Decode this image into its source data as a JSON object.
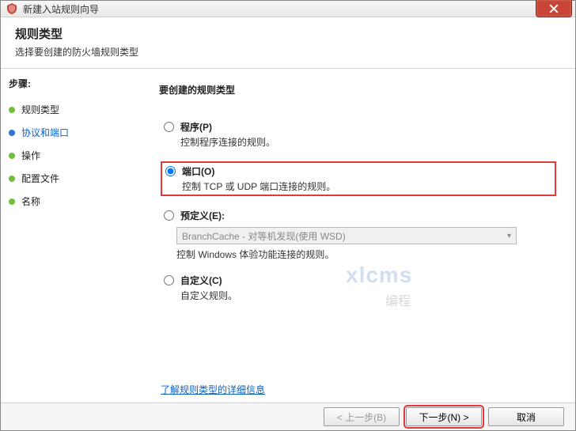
{
  "window": {
    "title": "新建入站规则向导"
  },
  "header": {
    "title": "规则类型",
    "subtitle": "选择要创建的防火墙规则类型"
  },
  "sidebar": {
    "steps_label": "步骤:",
    "items": [
      {
        "label": "规则类型"
      },
      {
        "label": "协议和端口"
      },
      {
        "label": "操作"
      },
      {
        "label": "配置文件"
      },
      {
        "label": "名称"
      }
    ]
  },
  "content": {
    "question": "要创建的规则类型",
    "options": {
      "program": {
        "title": "程序(P)",
        "desc": "控制程序连接的规则。"
      },
      "port": {
        "title": "端口(O)",
        "desc": "控制 TCP 或 UDP 端口连接的规则。"
      },
      "predef": {
        "title": "预定义(E):",
        "desc": "控制 Windows 体验功能连接的规则。",
        "dropdown": "BranchCache - 对等机发现(使用 WSD)"
      },
      "custom": {
        "title": "自定义(C)",
        "desc": "自定义规则。"
      }
    },
    "link": "了解规则类型的详细信息"
  },
  "footer": {
    "back": "< 上一步(B)",
    "next": "下一步(N) >",
    "cancel": "取消"
  },
  "watermark": {
    "line1": "xlcms",
    "line2": "编程"
  }
}
